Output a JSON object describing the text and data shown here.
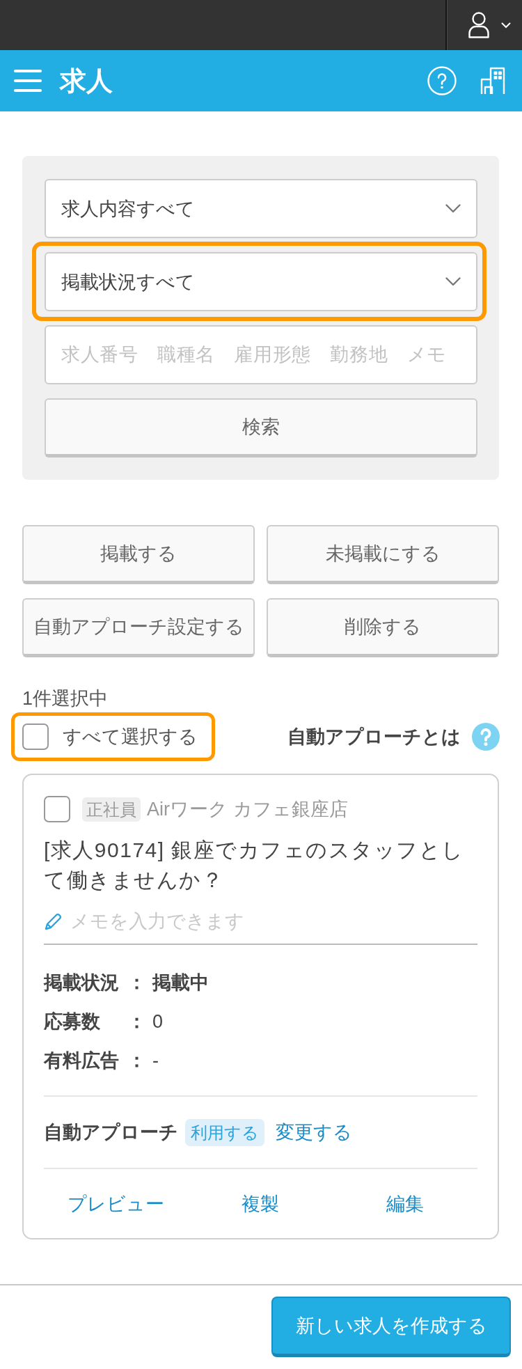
{
  "header": {
    "title": "求人"
  },
  "filters": {
    "selects": [
      {
        "value": "求人内容すべて",
        "highlighted": false
      },
      {
        "value": "掲載状況すべて",
        "highlighted": true
      }
    ],
    "keyword": {
      "placeholder": "求人番号　職種名　雇用形態　勤務地　メモ"
    },
    "search_button": "検索"
  },
  "bulk_actions": [
    "掲載する",
    "未掲載にする",
    "自動アプローチ設定する",
    "削除する"
  ],
  "selection": {
    "count": "1件選択中",
    "select_all": {
      "label": "すべて選択する",
      "checked": false,
      "highlighted": true
    },
    "help_link": "自動アプローチとは"
  },
  "jobs": [
    {
      "checked": false,
      "employment_tag": "正社員",
      "store": "Airワーク カフェ銀座店",
      "title": "[求人90174] 銀座でカフェのスタッフとして働きませんか？",
      "memo": {
        "placeholder": "メモを入力できます"
      },
      "details": [
        {
          "label": "掲載状況",
          "separator": "：",
          "value": "掲載中",
          "emphasized": true
        },
        {
          "label": "応募数",
          "separator": "：",
          "value": "0",
          "emphasized": false
        },
        {
          "label": "有料広告",
          "separator": "：",
          "value": "-",
          "emphasized": false
        }
      ],
      "auto_approach": {
        "label": "自動アプローチ",
        "status": "利用する",
        "change_link": "変更する"
      },
      "actions": [
        "プレビュー",
        "複製",
        "編集"
      ]
    }
  ],
  "footer": {
    "create_button": "新しい求人を作成する"
  }
}
